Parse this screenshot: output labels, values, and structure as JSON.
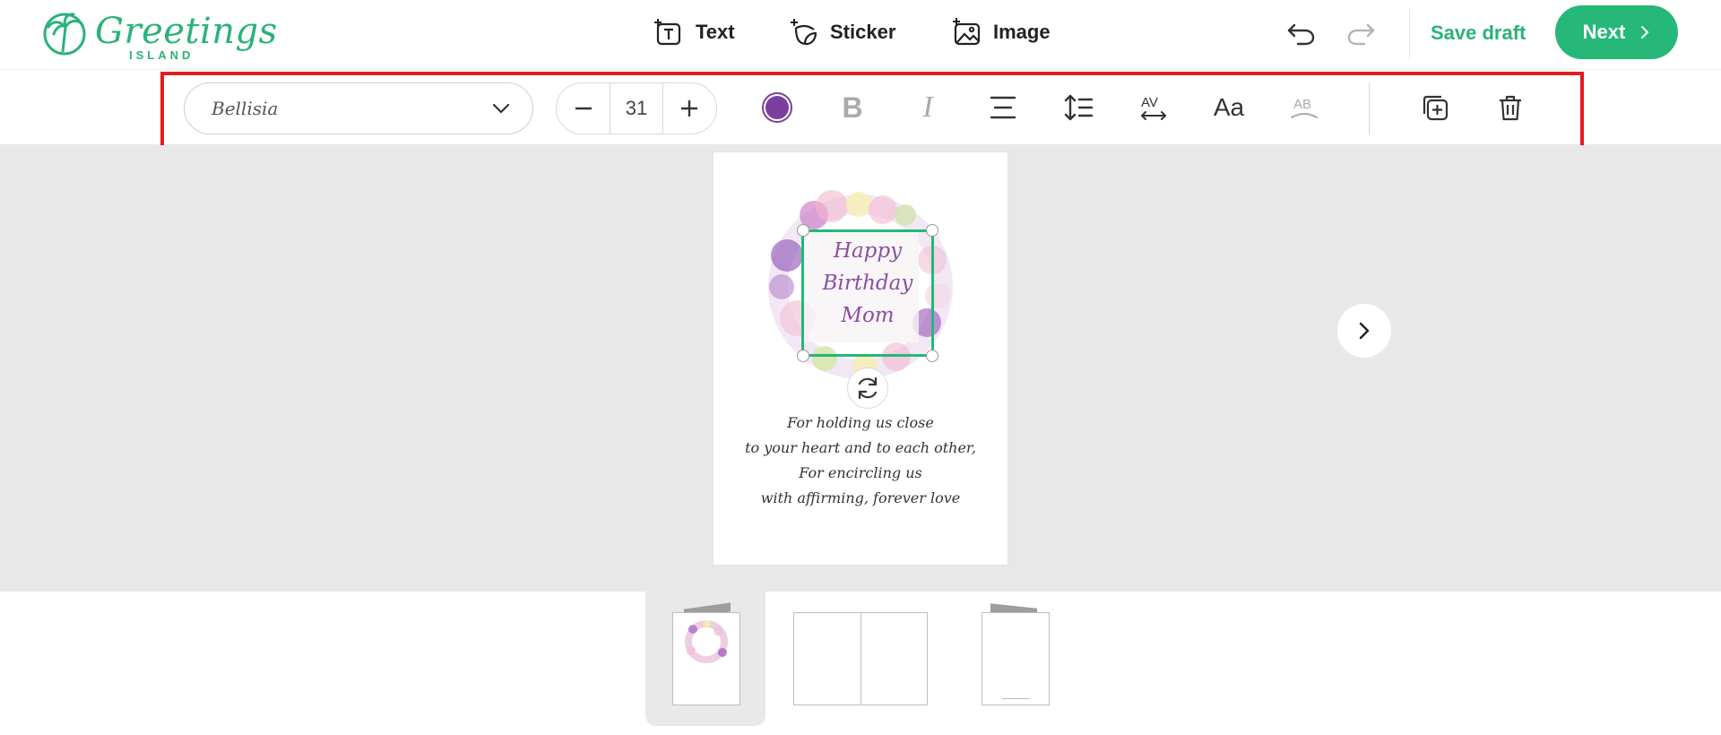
{
  "header": {
    "logo_text": "Greetings",
    "logo_sub": "ISLAND",
    "text_label": "Text",
    "sticker_label": "Sticker",
    "image_label": "Image",
    "save_draft_label": "Save draft",
    "next_label": "Next"
  },
  "toolbar": {
    "font_name": "Bellisia",
    "font_size": "31",
    "color": "#7b3fa0",
    "bold_label": "B",
    "italic_label": "I",
    "case_label": "Aa"
  },
  "card": {
    "headline": [
      "Happy",
      "Birthday",
      "Mom"
    ],
    "verse": [
      "For holding us close",
      "to your heart and to each other,",
      "For encircling us",
      "with affirming, forever love"
    ]
  },
  "colors": {
    "brand": "#2bb27a",
    "next_button": "#26b878",
    "highlight": "#e11d1d",
    "selection": "#22b97a",
    "canvas_bg": "#e8e8e8"
  }
}
